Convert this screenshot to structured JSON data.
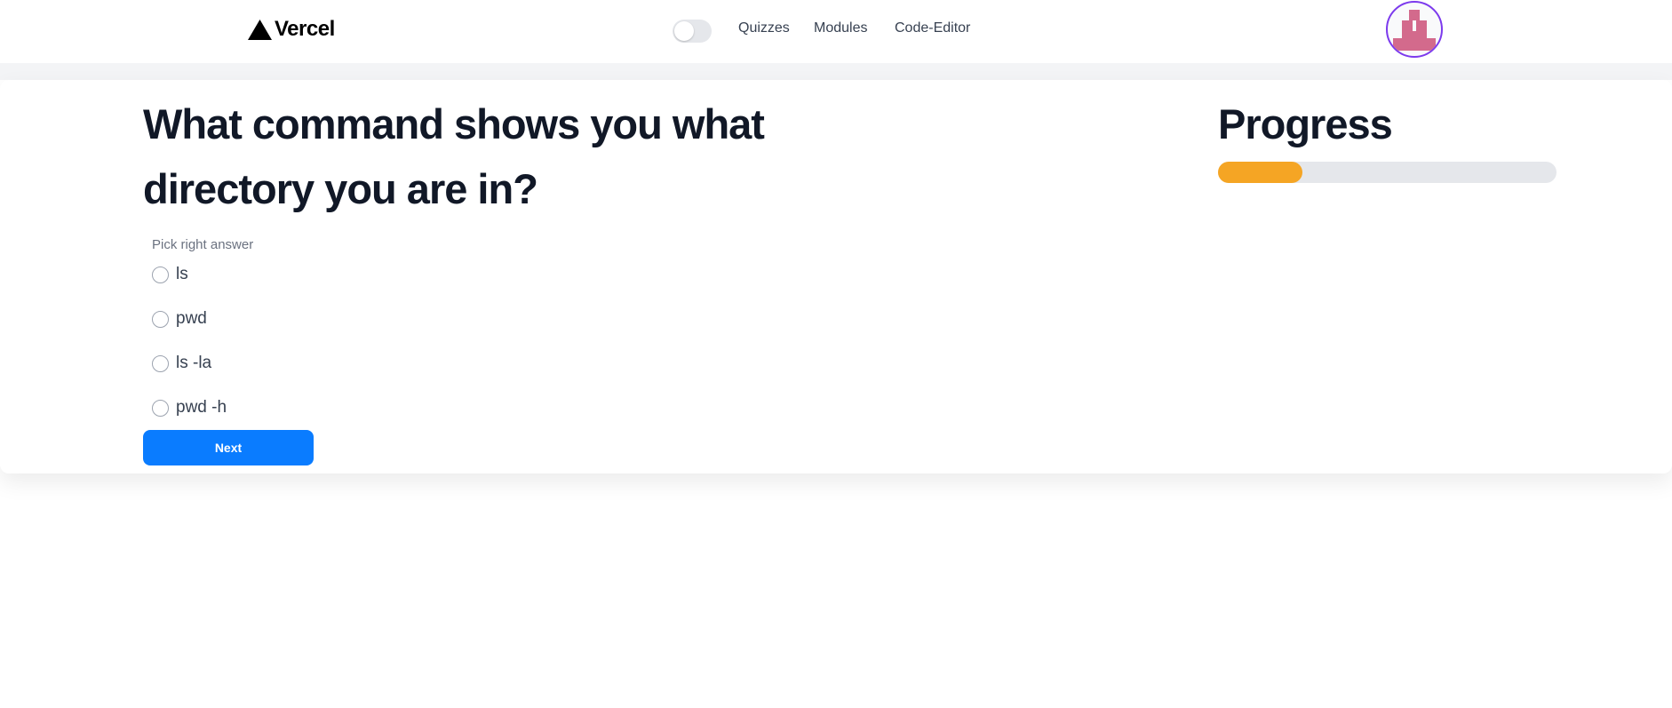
{
  "header": {
    "brand_name": "Vercel",
    "nav": {
      "quizzes": "Quizzes",
      "modules": "Modules",
      "code_editor": "Code-Editor"
    },
    "theme_toggle_on": false,
    "avatar_icon": "pixel-avatar-icon"
  },
  "quiz": {
    "question": "What command shows you what directory you are in?",
    "instruction": "Pick right answer",
    "options": [
      "ls",
      "pwd",
      "ls -la",
      "pwd -h"
    ],
    "next_label": "Next"
  },
  "progress": {
    "title": "Progress",
    "fraction": 0.25
  },
  "colors": {
    "accent_blue": "#0a7cff",
    "progress_fill": "#f5a524",
    "progress_track": "#e5e7eb",
    "avatar_ring": "#7c3aed",
    "avatar_pixels": "#d36a8c"
  }
}
